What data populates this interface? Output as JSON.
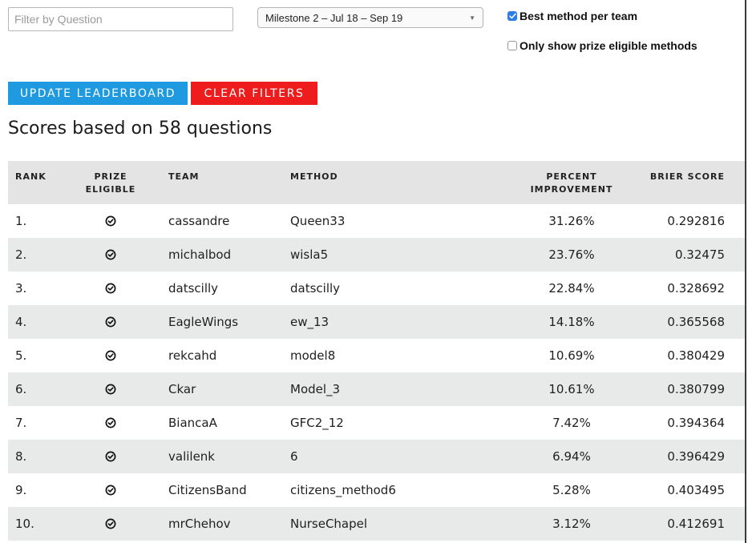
{
  "filters": {
    "question_placeholder": "Filter by Question",
    "question_value": "",
    "milestone_selected": "Milestone 2 – Jul 18 – Sep 19",
    "best_method_label": "Best method per team",
    "best_method_checked": true,
    "prize_only_label": "Only show prize eligible methods",
    "prize_only_checked": false
  },
  "buttons": {
    "update_label": "UPDATE LEADERBOARD",
    "clear_label": "CLEAR FILTERS"
  },
  "colors": {
    "update_button": "#1f9ae0",
    "clear_button": "#ee1c1c",
    "header_row": "#e4e4e4",
    "alt_row": "#e8e9e9",
    "checkbox_checked": "#2b7de9"
  },
  "summary": {
    "title": "Scores based on 58 questions"
  },
  "table": {
    "headers": {
      "rank": "RANK",
      "prize_line1": "PRIZE",
      "prize_line2": "ELIGIBLE",
      "team": "TEAM",
      "method": "METHOD",
      "pct_line1": "PERCENT",
      "pct_line2": "IMPROVEMENT",
      "brier": "BRIER SCORE"
    },
    "prize_icon": "check-circle-icon",
    "rows": [
      {
        "rank": "1.",
        "prize_eligible": true,
        "team": "cassandre",
        "method": "Queen33",
        "percent": "31.26%",
        "brier": "0.292816"
      },
      {
        "rank": "2.",
        "prize_eligible": true,
        "team": "michalbod",
        "method": "wisla5",
        "percent": "23.76%",
        "brier": "0.32475"
      },
      {
        "rank": "3.",
        "prize_eligible": true,
        "team": "datscilly",
        "method": "datscilly",
        "percent": "22.84%",
        "brier": "0.328692"
      },
      {
        "rank": "4.",
        "prize_eligible": true,
        "team": "EagleWings",
        "method": "ew_13",
        "percent": "14.18%",
        "brier": "0.365568"
      },
      {
        "rank": "5.",
        "prize_eligible": true,
        "team": "rekcahd",
        "method": "model8",
        "percent": "10.69%",
        "brier": "0.380429"
      },
      {
        "rank": "6.",
        "prize_eligible": true,
        "team": "Ckar",
        "method": "Model_3",
        "percent": "10.61%",
        "brier": "0.380799"
      },
      {
        "rank": "7.",
        "prize_eligible": true,
        "team": "BiancaA",
        "method": "GFC2_12",
        "percent": "7.42%",
        "brier": "0.394364"
      },
      {
        "rank": "8.",
        "prize_eligible": true,
        "team": "valilenk",
        "method": "6",
        "percent": "6.94%",
        "brier": "0.396429"
      },
      {
        "rank": "9.",
        "prize_eligible": true,
        "team": "CitizensBand",
        "method": "citizens_method6",
        "percent": "5.28%",
        "brier": "0.403495"
      },
      {
        "rank": "10.",
        "prize_eligible": true,
        "team": "mrChehov",
        "method": "NurseChapel",
        "percent": "3.12%",
        "brier": "0.412691"
      }
    ]
  }
}
